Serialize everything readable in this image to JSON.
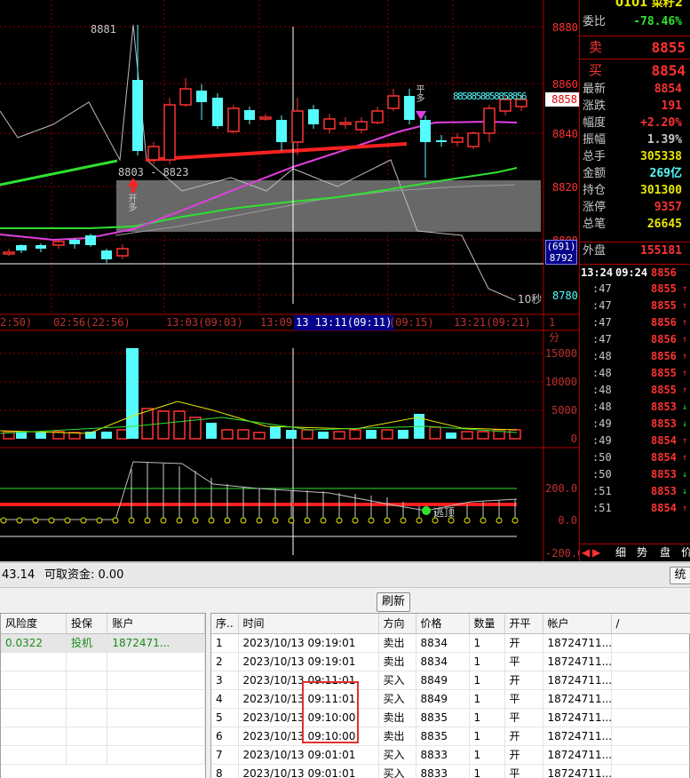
{
  "colors": {
    "up": "#ff3232",
    "down": "#54fcfc",
    "grid": "#8b0000",
    "ma1": "#e040e0",
    "ma2": "#30e030",
    "text": "#c8c8c8"
  },
  "chart": {
    "price_axis": [
      "8880",
      "8860",
      "8840",
      "8820",
      "8800",
      "8780"
    ],
    "price_current": "8858",
    "overlay_box_top": "(691)",
    "overlay_box_bottom": "8792",
    "label_high": "8881",
    "label_range": "8803 - 8823",
    "label_10s": "10秒",
    "label_kaiduo_1": "开多",
    "label_kaiduo_2": "开多",
    "label_pingduo": "平多",
    "price_run": "8858858858858856",
    "time_axis": [
      "2:50)",
      "02:56(22:56)",
      "13:03(09:03)",
      "13:09",
      "13 13:11(09:11)",
      "(09:15)",
      "13:21(09:21)",
      "1分"
    ],
    "vol_axis": [
      "15000",
      "10000",
      "5000",
      "0"
    ],
    "ind_axis": [
      "200.0",
      "0.0",
      "-200.0"
    ],
    "escape_label": "逃顶"
  },
  "quote": {
    "top_title": "0101 菜籽2",
    "rows": [
      {
        "label": "委比",
        "value": "-78.46%",
        "color": "#30e030"
      },
      {
        "label": "卖",
        "value": "8855",
        "color": "#ff3232"
      },
      {
        "label": "买",
        "value": "8854",
        "color": "#ff3232"
      },
      {
        "label": "最新",
        "value": "8854",
        "color": "#ff3232"
      },
      {
        "label": "涨跌",
        "value": "191",
        "color": "#ff3232"
      },
      {
        "label": "幅度",
        "value": "+2.20%",
        "color": "#ff3232"
      },
      {
        "label": "振幅",
        "value": "1.39%",
        "color": "#c8c8c8"
      },
      {
        "label": "总手",
        "value": "305338",
        "color": "#e8e800"
      },
      {
        "label": "金额",
        "value": "269亿",
        "color": "#54fcfc"
      },
      {
        "label": "持仓",
        "value": "301300",
        "color": "#e8e800"
      },
      {
        "label": "涨停",
        "value": "9357",
        "color": "#ff3232"
      },
      {
        "label": "总笔",
        "value": "26645",
        "color": "#e8e800"
      },
      {
        "label": "外盘",
        "value": "155181",
        "color": "#ff3232"
      }
    ],
    "ticks_header_time": "13:24",
    "ticks_header_time2": "09:24",
    "ticks_header_price": "8856",
    "ticks": [
      {
        "time": ":47",
        "price": "8855",
        "dir": "up"
      },
      {
        "time": ":47",
        "price": "8855",
        "dir": "up"
      },
      {
        "time": ":47",
        "price": "8856",
        "dir": "up"
      },
      {
        "time": ":47",
        "price": "8856",
        "dir": "up"
      },
      {
        "time": ":48",
        "price": "8856",
        "dir": "up"
      },
      {
        "time": ":48",
        "price": "8855",
        "dir": "up"
      },
      {
        "time": ":48",
        "price": "8855",
        "dir": "up"
      },
      {
        "time": ":48",
        "price": "8853",
        "dir": "down"
      },
      {
        "time": ":49",
        "price": "8853",
        "dir": "down"
      },
      {
        "time": ":49",
        "price": "8854",
        "dir": "up"
      },
      {
        "time": ":50",
        "price": "8854",
        "dir": "up"
      },
      {
        "time": ":50",
        "price": "8853",
        "dir": "down"
      },
      {
        "time": ":51",
        "price": "8853",
        "dir": "down"
      },
      {
        "time": ":51",
        "price": "8854",
        "dir": "up"
      }
    ],
    "tabs": [
      "细",
      "势",
      "盘",
      "价"
    ]
  },
  "bottom": {
    "status_prefix": "43.14",
    "available_label": "可取资金: 0.00",
    "close_button": "统",
    "refresh_button": "刷新",
    "left_table": {
      "headers": [
        "风险度",
        "投保",
        "账户"
      ],
      "rows": [
        [
          "0.0322",
          "投机",
          "1872471..."
        ]
      ]
    },
    "right_table": {
      "headers": [
        "序..",
        "时间",
        "方向",
        "价格",
        "数量",
        "开平",
        "帐户",
        "/"
      ],
      "rows": [
        [
          "1",
          "2023/10/13 09:19:01",
          "卖出",
          "8834",
          "1",
          "开",
          "18724711..."
        ],
        [
          "2",
          "2023/10/13 09:19:01",
          "卖出",
          "8834",
          "1",
          "平",
          "18724711..."
        ],
        [
          "3",
          "2023/10/13 09:11:01",
          "买入",
          "8849",
          "1",
          "开",
          "18724711..."
        ],
        [
          "4",
          "2023/10/13 09:11:01",
          "买入",
          "8849",
          "1",
          "平",
          "18724711..."
        ],
        [
          "5",
          "2023/10/13 09:10:00",
          "卖出",
          "8835",
          "1",
          "平",
          "18724711..."
        ],
        [
          "6",
          "2023/10/13 09:10:00",
          "卖出",
          "8835",
          "1",
          "开",
          "18724711..."
        ],
        [
          "7",
          "2023/10/13 09:01:01",
          "买入",
          "8833",
          "1",
          "开",
          "18724711..."
        ],
        [
          "8",
          "2023/10/13 09:01:01",
          "买入",
          "8833",
          "1",
          "平",
          "18724711..."
        ]
      ]
    }
  }
}
